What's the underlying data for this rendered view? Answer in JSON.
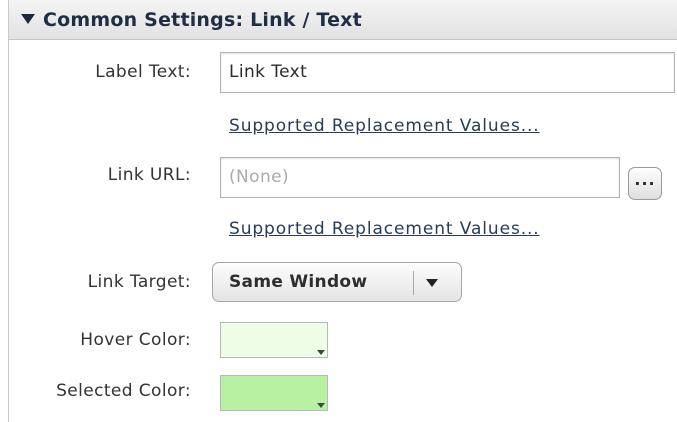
{
  "section": {
    "title": "Common Settings: Link / Text"
  },
  "fields": {
    "label_text": {
      "label": "Label Text:",
      "value": "Link Text",
      "help_link": "Supported Replacement Values..."
    },
    "link_url": {
      "label": "Link URL:",
      "placeholder": "(None)",
      "browse_button": "...",
      "help_link": "Supported Replacement Values..."
    },
    "link_target": {
      "label": "Link Target:",
      "selected": "Same Window"
    },
    "hover_color": {
      "label": "Hover Color:",
      "color": "#eefee6"
    },
    "selected_color": {
      "label": "Selected Color:",
      "color": "#b8f1a2"
    }
  }
}
